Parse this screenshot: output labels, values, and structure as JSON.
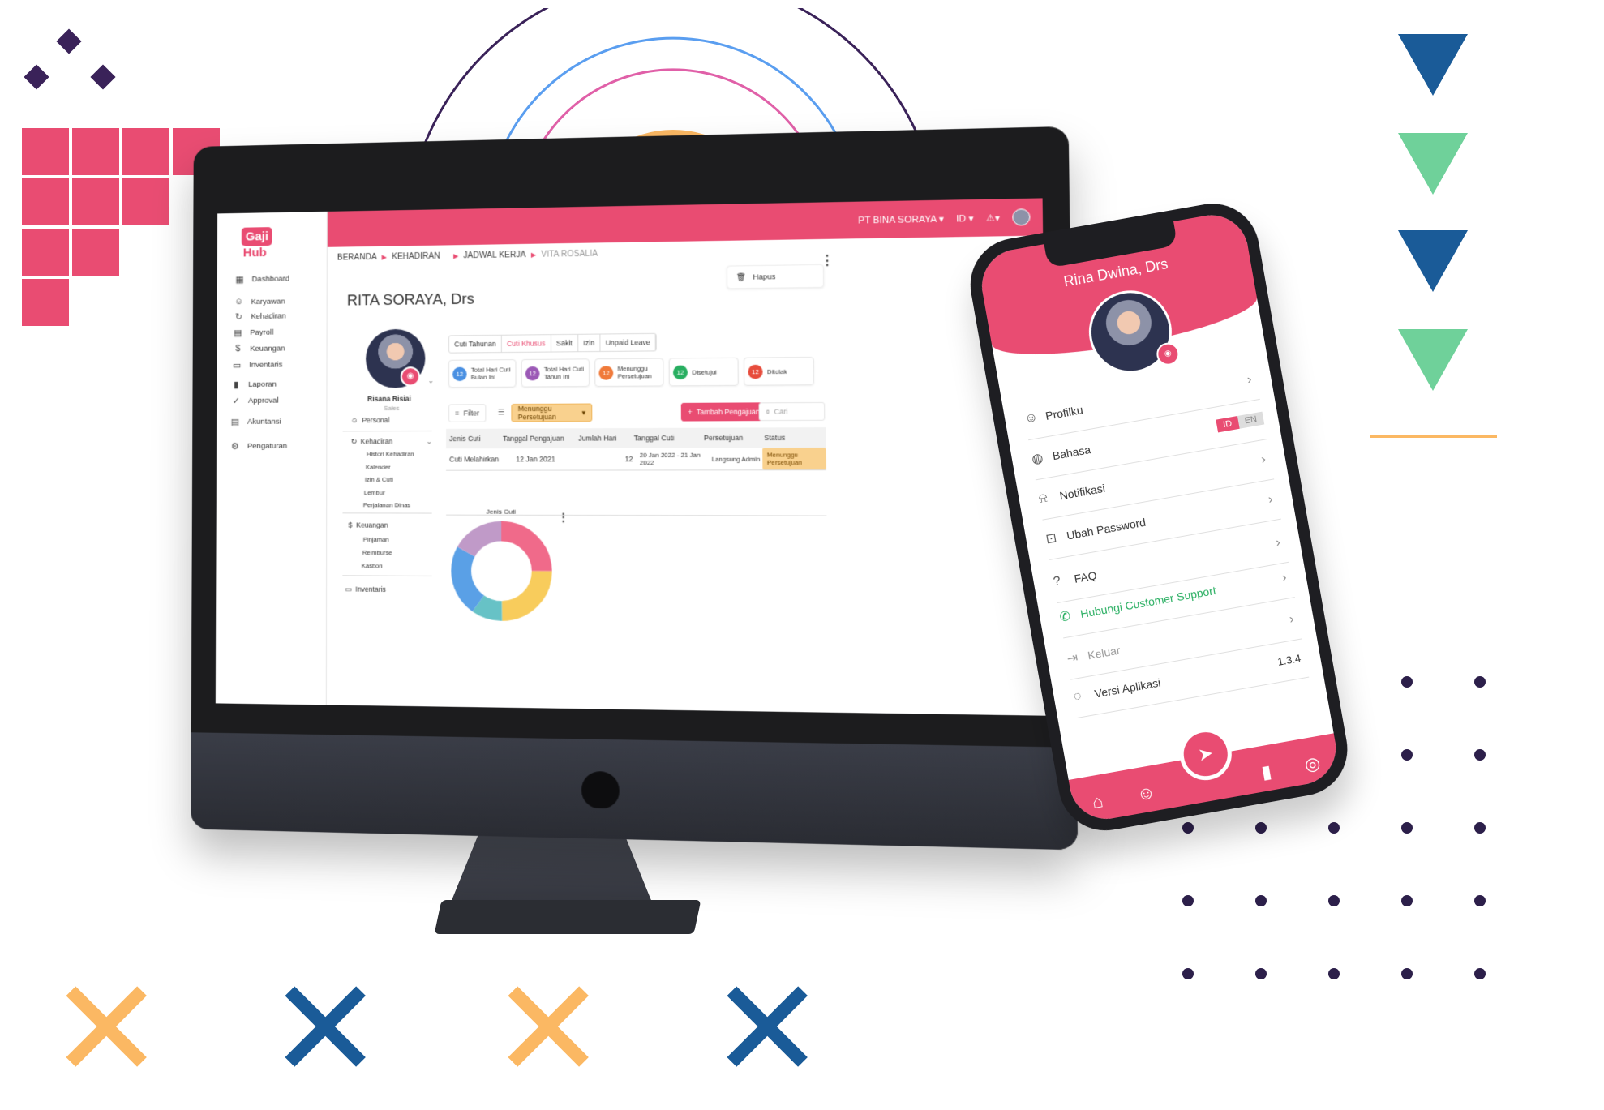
{
  "colors": {
    "brand": "#e94c72",
    "navy": "#1a5b98",
    "green": "#6fd19a",
    "orange": "#fbb863",
    "dark": "#2c1f4a"
  },
  "topbar": {
    "company": "PT BINA SORAYA ▾",
    "lang": "ID ▾",
    "bell": "⚠▾"
  },
  "logo": {
    "left": "Gaji",
    "right": "Hub"
  },
  "sidebar": {
    "items": [
      {
        "label": "Dashboard",
        "icon": "dashboard-icon",
        "glyph": "▦"
      },
      {
        "label": "Karyawan",
        "icon": "karyawan-icon",
        "glyph": "☺"
      },
      {
        "label": "Kehadiran",
        "icon": "kehadiran-icon",
        "glyph": "↻"
      },
      {
        "label": "Payroll",
        "icon": "payroll-icon",
        "glyph": "▤"
      },
      {
        "label": "Keuangan",
        "icon": "keuangan-icon",
        "glyph": "$"
      },
      {
        "label": "Inventaris",
        "icon": "inventaris-icon",
        "glyph": "▭"
      },
      {
        "label": "Laporan",
        "icon": "laporan-icon",
        "glyph": "▮"
      },
      {
        "label": "Approval",
        "icon": "approval-icon",
        "glyph": "✓"
      },
      {
        "label": "Akuntansi",
        "icon": "akuntansi-icon",
        "glyph": "▤"
      },
      {
        "label": "Pengaturan",
        "icon": "pengaturan-icon",
        "glyph": "⚙"
      }
    ]
  },
  "breadcrumb": {
    "a": "BERANDA",
    "b": "KEHADIRAN",
    "c": "JADWAL KERJA",
    "d": "VITA ROSALIA"
  },
  "page": {
    "title": "RITA SORAYA, Drs",
    "delete_label": "Hapus"
  },
  "profile": {
    "name": "Risana Risiai",
    "role": "Sales"
  },
  "subnav": {
    "personal": "Personal",
    "kehadiran": "Kehadiran",
    "kehadiran_items": [
      "Histori Kehadiran",
      "Kalender",
      "Izin & Cuti",
      "Lembur",
      "Perjalanan Dinas"
    ],
    "keuangan": "Keuangan",
    "keuangan_items": [
      "Pinjaman",
      "Reimburse",
      "Kasbon"
    ],
    "inventaris": "Inventaris"
  },
  "tabs": [
    "Cuti Tahunan",
    "Cuti Khusus",
    "Sakit",
    "Izin",
    "Unpaid Leave"
  ],
  "stats": [
    {
      "count": "12",
      "label": "Total Hari Cuti Bulan Ini",
      "color": "#4a90e2"
    },
    {
      "count": "12",
      "label": "Total Hari Cuti Tahun Ini",
      "color": "#9b59b6"
    },
    {
      "count": "12",
      "label": "Menunggu Persetujuan",
      "color": "#f07a3a"
    },
    {
      "count": "12",
      "label": "Disetujui",
      "color": "#27ae60"
    },
    {
      "count": "12",
      "label": "Ditolak",
      "color": "#e74c3c"
    }
  ],
  "filters": {
    "filter": "Filter",
    "status": "Menunggu Persetujuan",
    "add": "Tambah Pengajuan",
    "search_placeholder": "Cari"
  },
  "table": {
    "headers": [
      "Jenis Cuti",
      "Tanggal Pengajuan",
      "Jumlah Hari",
      "Tanggal Cuti",
      "Persetujuan",
      "Status"
    ],
    "rows": [
      {
        "jenis": "Cuti Melahirkan",
        "tanggal": "12 Jan 2021",
        "jumlah": "12",
        "cuti": "20 Jan 2022 - 21 Jan 2022",
        "persetujuan": "Langsung Admin",
        "status": "Menunggu Persetujuan"
      }
    ]
  },
  "donut": {
    "title": "Jenis Cuti"
  },
  "phone": {
    "name": "Rina Dwina, Drs",
    "menu": [
      {
        "label": "Profilku",
        "icon": "profile-icon",
        "glyph": "☺"
      },
      {
        "label": "Bahasa",
        "icon": "language-icon",
        "glyph": "◍"
      },
      {
        "label": "Notifikasi",
        "icon": "bell-icon",
        "glyph": "⍾"
      },
      {
        "label": "Ubah Password",
        "icon": "lock-icon",
        "glyph": "⊡"
      },
      {
        "label": "FAQ",
        "icon": "help-icon",
        "glyph": "?"
      },
      {
        "label": "Hubungi Customer Support",
        "icon": "whatsapp-icon",
        "glyph": "✆"
      },
      {
        "label": "Keluar",
        "icon": "logout-icon",
        "glyph": "⇥"
      },
      {
        "label": "Versi Aplikasi",
        "icon": "version-icon",
        "glyph": "◌"
      }
    ],
    "lang_id": "ID",
    "lang_en": "EN",
    "version": "1.3.4"
  }
}
